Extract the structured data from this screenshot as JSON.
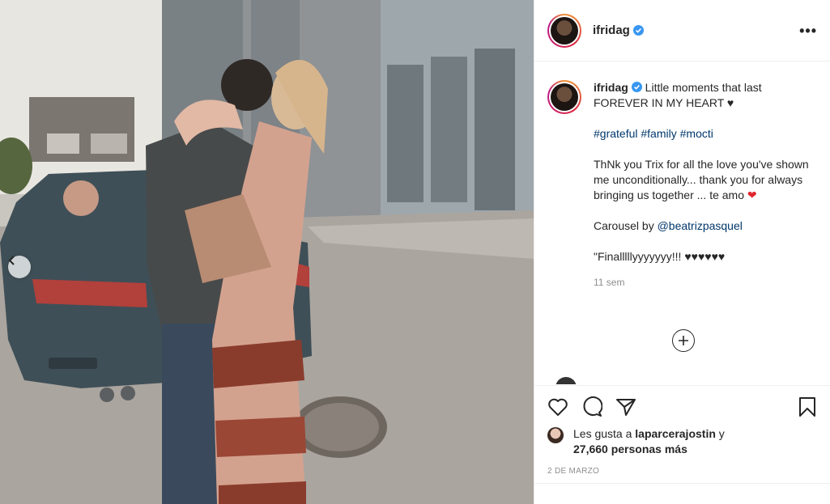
{
  "post": {
    "username": "ifridag",
    "verified": true,
    "more_label": "•••"
  },
  "caption": {
    "line1": "Little moments that last FOREVER IN MY HEART ♥",
    "hashtags": [
      "#grateful",
      "#family",
      "#mocti"
    ],
    "line2": "ThNk you Trix for all the love you've shown me unconditionally... thank you for always bringing us together ... te amo",
    "line2_emoji": "❤",
    "carousel_prefix": "Carousel by ",
    "carousel_mention": "@beatrizpasquel",
    "line4": "\"Finalllllyyyyyyy!!! ♥♥♥♥♥♥",
    "time_ago": "11 sem"
  },
  "likes": {
    "prefix": "Les gusta a ",
    "liker": "laparcerajostin",
    "connector": " y",
    "count_text": "27,660 personas más"
  },
  "date": "2 DE MARZO",
  "icons": {
    "like": "heart-outline-icon",
    "comment": "comment-bubble-icon",
    "share": "paper-plane-icon",
    "save": "bookmark-icon",
    "load_more": "plus-circle-icon",
    "carousel_prev": "chevron-left-icon",
    "verified": "verified-badge-icon"
  },
  "colors": {
    "text": "#262626",
    "muted": "#8e8e8e",
    "link": "#00376b",
    "verified": "#3897f0",
    "divider": "#efefef"
  }
}
